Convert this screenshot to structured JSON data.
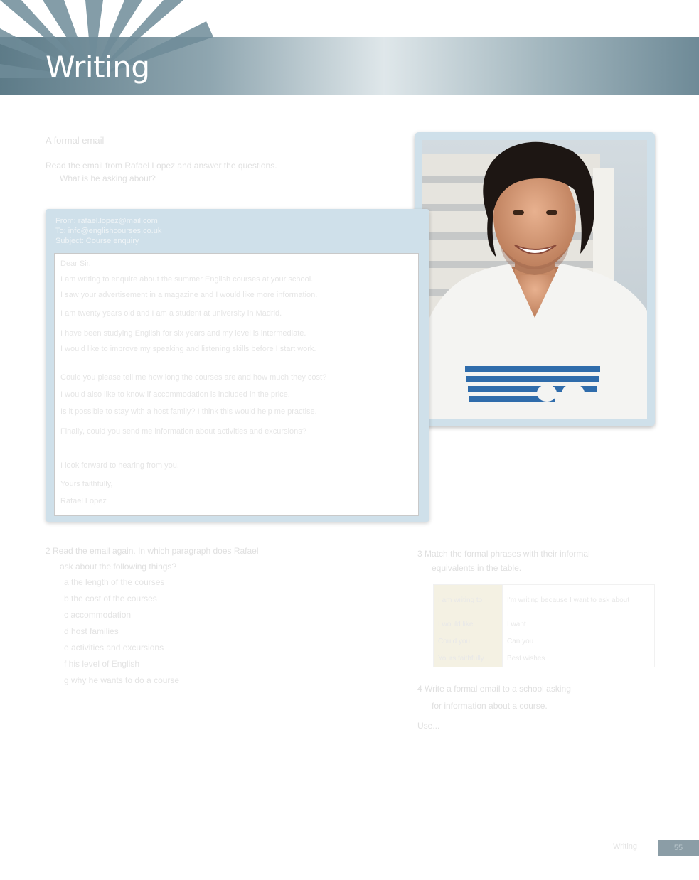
{
  "header": {
    "title": "Writing"
  },
  "intro": {
    "heading": "A formal email",
    "instruction_line1": "Read the email from Rafael Lopez and answer the questions.",
    "instruction_line2": "What is he asking about?"
  },
  "email": {
    "meta": [
      "From: rafael.lopez@mail.com",
      "To: info@englishcourses.co.uk",
      "Subject: Course enquiry"
    ],
    "greeting": "Dear Sir,",
    "paragraphs": [
      "I am writing to enquire about the summer English courses at your school.",
      "I saw your advertisement in a magazine and I would like more information.",
      "I am twenty years old and I am a student at university in Madrid.",
      "I have been studying English for six years and my level is intermediate.",
      "I would like to improve my speaking and listening skills before I start work.",
      "Could you please tell me how long the courses are and how much they cost?",
      "I would also like to know if accommodation is included in the price.",
      "Is it possible to stay with a host family? I think this would help me practise.",
      "Finally, could you send me information about activities and excursions?",
      "I look forward to hearing from you.",
      "Yours faithfully,",
      "Rafael Lopez"
    ]
  },
  "question2": {
    "text_line1": "2 Read the email again. In which paragraph does Rafael",
    "text_line2": "ask about the following things?",
    "items": [
      "a the length of the courses",
      "b the cost of the courses",
      "c accommodation",
      "d host families",
      "e activities and excursions",
      "f his level of English",
      "g why he wants to do a course"
    ]
  },
  "question3": {
    "text_line1": "3 Match the formal phrases with their informal",
    "text_line2": "equivalents in the table.",
    "rows": [
      {
        "k": "I am writing to",
        "v": "I'm writing because I want to ask about"
      },
      {
        "k": "I would like",
        "v": "I want"
      },
      {
        "k": "Could you",
        "v": "Can you"
      },
      {
        "k": "Yours faithfully",
        "v": "Best wishes"
      }
    ]
  },
  "question4": {
    "text_line1": "4 Write a formal email to a school asking",
    "text_line2": "for information about a course.",
    "extra": "Use..."
  },
  "footer": {
    "label": "Writing",
    "page": "55"
  }
}
